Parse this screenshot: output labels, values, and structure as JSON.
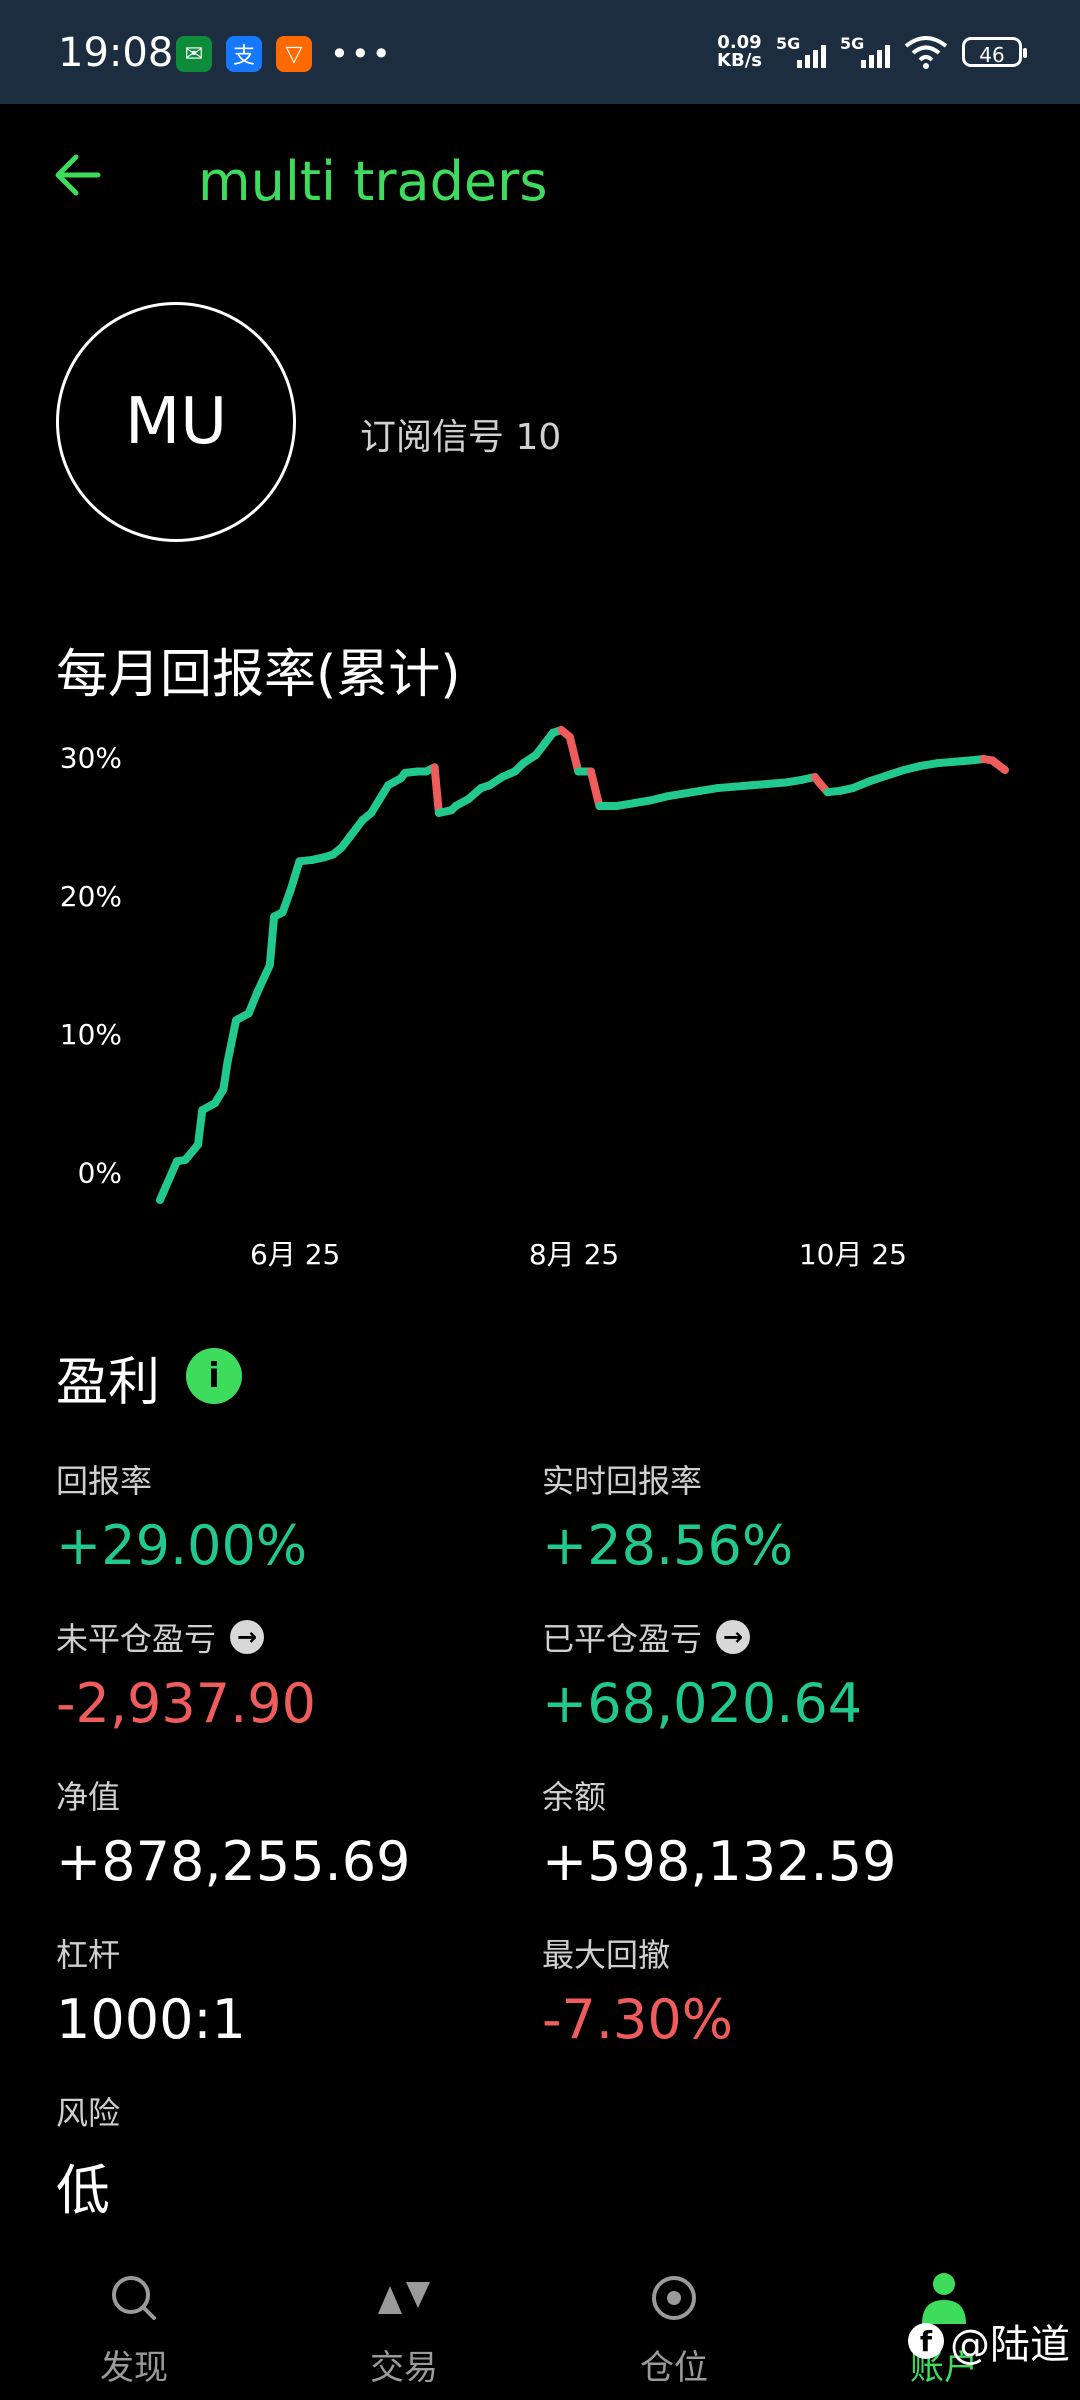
{
  "status_bar": {
    "time": "19:08",
    "net_speed_value": "0.09",
    "net_speed_unit": "KB/s",
    "sim1": "5G",
    "sim2": "5G",
    "battery": "46",
    "dots": "•••"
  },
  "header": {
    "title": "multi traders"
  },
  "profile": {
    "avatar_initials": "MU",
    "subscription": "订阅信号 10"
  },
  "chart_section": {
    "title": "每月回报率(累计)"
  },
  "chart_data": {
    "type": "line",
    "y_tick_labels": [
      "30%",
      "20%",
      "10%",
      "0%"
    ],
    "y_ticks": [
      30,
      20,
      10,
      0
    ],
    "x_tick_labels": [
      "6月 25",
      "8月 25",
      "10月 25"
    ],
    "x_ticks": [
      0.16,
      0.49,
      0.82
    ],
    "ylim": [
      -2,
      32
    ],
    "colors": {
      "up": "#22c98e",
      "down": "#ee5c5c"
    },
    "points": [
      [
        0.0,
        -2.0
      ],
      [
        0.02,
        0.8
      ],
      [
        0.03,
        0.9
      ],
      [
        0.045,
        2.0
      ],
      [
        0.05,
        4.5
      ],
      [
        0.065,
        5.0
      ],
      [
        0.075,
        6.0
      ],
      [
        0.08,
        8.0
      ],
      [
        0.09,
        11.0
      ],
      [
        0.105,
        11.5
      ],
      [
        0.115,
        13.0
      ],
      [
        0.13,
        15.0
      ],
      [
        0.135,
        18.5
      ],
      [
        0.145,
        18.8
      ],
      [
        0.155,
        20.5
      ],
      [
        0.165,
        22.5
      ],
      [
        0.18,
        22.6
      ],
      [
        0.195,
        22.8
      ],
      [
        0.205,
        23.0
      ],
      [
        0.215,
        23.5
      ],
      [
        0.225,
        24.3
      ],
      [
        0.24,
        25.5
      ],
      [
        0.25,
        26.0
      ],
      [
        0.26,
        27.0
      ],
      [
        0.27,
        28.0
      ],
      [
        0.285,
        28.5
      ],
      [
        0.29,
        28.9
      ],
      [
        0.305,
        29.0
      ],
      [
        0.315,
        29.0
      ],
      [
        0.325,
        29.3
      ],
      [
        0.33,
        26.0
      ],
      [
        0.345,
        26.2
      ],
      [
        0.35,
        26.5
      ],
      [
        0.365,
        27.0
      ],
      [
        0.38,
        27.8
      ],
      [
        0.39,
        28.0
      ],
      [
        0.405,
        28.6
      ],
      [
        0.42,
        29.0
      ],
      [
        0.43,
        29.6
      ],
      [
        0.445,
        30.2
      ],
      [
        0.455,
        31.0
      ],
      [
        0.465,
        31.8
      ],
      [
        0.475,
        32.0
      ],
      [
        0.485,
        31.5
      ],
      [
        0.495,
        29.0
      ],
      [
        0.51,
        29.0
      ],
      [
        0.52,
        26.5
      ],
      [
        0.54,
        26.5
      ],
      [
        0.56,
        26.7
      ],
      [
        0.58,
        26.9
      ],
      [
        0.6,
        27.2
      ],
      [
        0.62,
        27.4
      ],
      [
        0.64,
        27.6
      ],
      [
        0.66,
        27.8
      ],
      [
        0.68,
        27.9
      ],
      [
        0.7,
        28.0
      ],
      [
        0.72,
        28.1
      ],
      [
        0.74,
        28.2
      ],
      [
        0.76,
        28.4
      ],
      [
        0.775,
        28.6
      ],
      [
        0.78,
        28.2
      ],
      [
        0.79,
        27.5
      ],
      [
        0.805,
        27.6
      ],
      [
        0.82,
        27.8
      ],
      [
        0.84,
        28.3
      ],
      [
        0.86,
        28.7
      ],
      [
        0.88,
        29.1
      ],
      [
        0.9,
        29.4
      ],
      [
        0.92,
        29.6
      ],
      [
        0.94,
        29.7
      ],
      [
        0.96,
        29.8
      ],
      [
        0.975,
        29.9
      ],
      [
        0.985,
        29.8
      ],
      [
        1.0,
        29.1
      ]
    ]
  },
  "profit": {
    "title": "盈利",
    "info_glyph": "i",
    "arrow_glyph": "→",
    "return_label": "回报率",
    "return_value": "+29.00%",
    "realtime_label": "实时回报率",
    "realtime_value": "+28.56%",
    "floating_label": "未平仓盈亏",
    "floating_value": "-2,937.90",
    "closed_label": "已平仓盈亏",
    "closed_value": "+68,020.64",
    "equity_label": "净值",
    "equity_value": "+878,255.69",
    "balance_label": "余额",
    "balance_value": "+598,132.59",
    "leverage_label": "杠杆",
    "leverage_value": "1000:1",
    "drawdown_label": "最大回撤",
    "drawdown_value": "-7.30%",
    "risk_label": "风险",
    "risk_value": "低"
  },
  "bottom_nav": {
    "discover": "发现",
    "trade": "交易",
    "positions": "仓位",
    "account": "账户"
  },
  "watermark": {
    "fb_glyph": "f",
    "text": "@陆道"
  }
}
